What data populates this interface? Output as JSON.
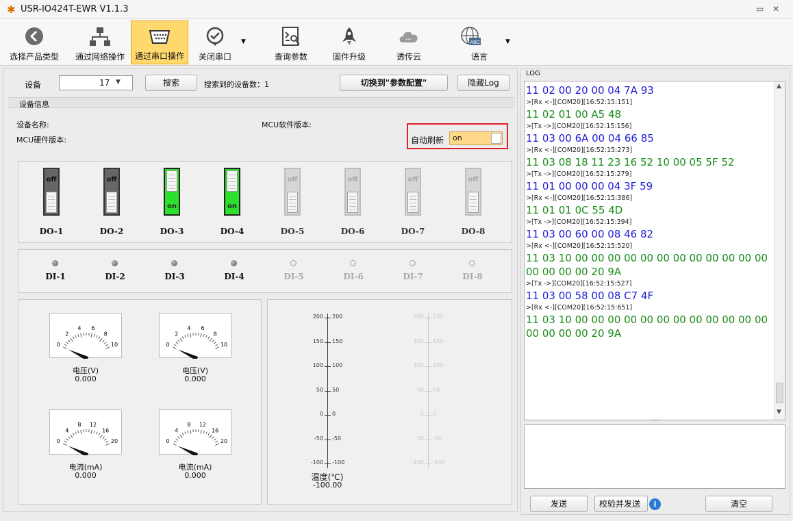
{
  "window": {
    "title": "USR-IO424T-EWR V1.1.3"
  },
  "toolbar": {
    "items": [
      {
        "label": "选择产品类型"
      },
      {
        "label": "通过网络操作"
      },
      {
        "label": "通过串口操作"
      },
      {
        "label": "关闭串口"
      },
      {
        "label": "查询参数"
      },
      {
        "label": "固件升级"
      },
      {
        "label": "透传云"
      },
      {
        "label": "语言"
      }
    ]
  },
  "device_bar": {
    "device_label": "设备",
    "device_value": "17",
    "search_button": "搜索",
    "found_label": "搜索到的设备数：1",
    "switch_button": "切换到\"参数配置\"",
    "hide_log_button": "隐藏Log"
  },
  "device_info": {
    "section_title": "设备信息",
    "device_name_label": "设备名称:",
    "mcu_sw_label": "MCU软件版本:",
    "mcu_hw_label": "MCU硬件版本:",
    "auto_refresh_label": "自动刷新",
    "auto_refresh_value": "on"
  },
  "outputs": [
    {
      "label": "DO-1",
      "state": "off",
      "enabled": true
    },
    {
      "label": "DO-2",
      "state": "off",
      "enabled": true
    },
    {
      "label": "DO-3",
      "state": "on",
      "enabled": true
    },
    {
      "label": "DO-4",
      "state": "on",
      "enabled": true
    },
    {
      "label": "DO-5",
      "state": "off",
      "enabled": false
    },
    {
      "label": "DO-6",
      "state": "off",
      "enabled": false
    },
    {
      "label": "DO-7",
      "state": "off",
      "enabled": false
    },
    {
      "label": "DO-8",
      "state": "off",
      "enabled": false
    }
  ],
  "inputs": [
    {
      "label": "DI-1",
      "enabled": true
    },
    {
      "label": "DI-2",
      "enabled": true
    },
    {
      "label": "DI-3",
      "enabled": true
    },
    {
      "label": "DI-4",
      "enabled": true
    },
    {
      "label": "DI-5",
      "enabled": false
    },
    {
      "label": "DI-6",
      "enabled": false
    },
    {
      "label": "DI-7",
      "enabled": false
    },
    {
      "label": "DI-8",
      "enabled": false
    }
  ],
  "gauges": [
    {
      "caption": "电压(V)",
      "value": "0.000",
      "ticks": [
        "0",
        "2",
        "4",
        "6",
        "8",
        "10"
      ]
    },
    {
      "caption": "电压(V)",
      "value": "0.000",
      "ticks": [
        "0",
        "2",
        "4",
        "6",
        "8",
        "10"
      ]
    },
    {
      "caption": "电流(mA)",
      "value": "0.000",
      "ticks": [
        "0",
        "4",
        "8",
        "12",
        "16",
        "20"
      ]
    },
    {
      "caption": "电流(mA)",
      "value": "0.000",
      "ticks": [
        "0",
        "4",
        "8",
        "12",
        "16",
        "20"
      ]
    }
  ],
  "thermometer": {
    "ticks": [
      "200",
      "150",
      "100",
      "50",
      "0",
      "-50",
      "-100"
    ],
    "caption": "温度(℃)",
    "value": "-100.00"
  },
  "log": {
    "title": "LOG",
    "lines": [
      {
        "kind": "hex",
        "color": "blue",
        "text": "11 02 00 20 00 04 7A 93"
      },
      {
        "kind": "meta",
        "text": ">[Rx <-][COM20][16:52:15:151]"
      },
      {
        "kind": "hex",
        "color": "green",
        "text": "11 02 01 00 A5 48"
      },
      {
        "kind": "meta",
        "text": ">[Tx ->][COM20][16:52:15:156]"
      },
      {
        "kind": "hex",
        "color": "blue",
        "text": "11 03 00 6A 00 04 66 85"
      },
      {
        "kind": "meta",
        "text": ">[Rx <-][COM20][16:52:15:273]"
      },
      {
        "kind": "hex",
        "color": "green",
        "text": "11 03 08 18 11 23 16 52 10 00 05 5F 52"
      },
      {
        "kind": "meta",
        "text": ">[Tx ->][COM20][16:52:15:279]"
      },
      {
        "kind": "hex",
        "color": "blue",
        "text": "11 01 00 00 00 04 3F 59"
      },
      {
        "kind": "meta",
        "text": ">[Rx <-][COM20][16:52:15:386]"
      },
      {
        "kind": "hex",
        "color": "green",
        "text": "11 01 01 0C 55 4D"
      },
      {
        "kind": "meta",
        "text": ">[Tx ->][COM20][16:52:15:394]"
      },
      {
        "kind": "hex",
        "color": "blue",
        "text": "11 03 00 60 00 08 46 82"
      },
      {
        "kind": "meta",
        "text": ">[Rx <-][COM20][16:52:15:520]"
      },
      {
        "kind": "hex",
        "color": "green",
        "text": "11 03 10 00 00 00 00 00 00 00 00 00 00 00 00"
      },
      {
        "kind": "hex",
        "color": "green",
        "text": "00 00 00 00 20 9A"
      },
      {
        "kind": "meta",
        "text": ">[Tx ->][COM20][16:52:15:527]"
      },
      {
        "kind": "hex",
        "color": "blue",
        "text": "11 03 00 58 00 08 C7 4F"
      },
      {
        "kind": "meta",
        "text": ">[Rx <-][COM20][16:52:15:651]"
      },
      {
        "kind": "hex",
        "color": "green",
        "text": "11 03 10 00 00 00 00 00 00 00 00 00 00 00 00"
      },
      {
        "kind": "hex",
        "color": "green",
        "text": "00 00 00 00 20 9A"
      }
    ],
    "send_button": "发送",
    "checksum_send_button": "校验并发送",
    "clear_button": "清空"
  },
  "colors": {
    "active_toolbar": "#ffd86e",
    "on_green": "#2ee02e",
    "hex_blue": "#1f1fd6",
    "hex_green": "#1a8c1a",
    "highlight_red": "#e0202a"
  }
}
